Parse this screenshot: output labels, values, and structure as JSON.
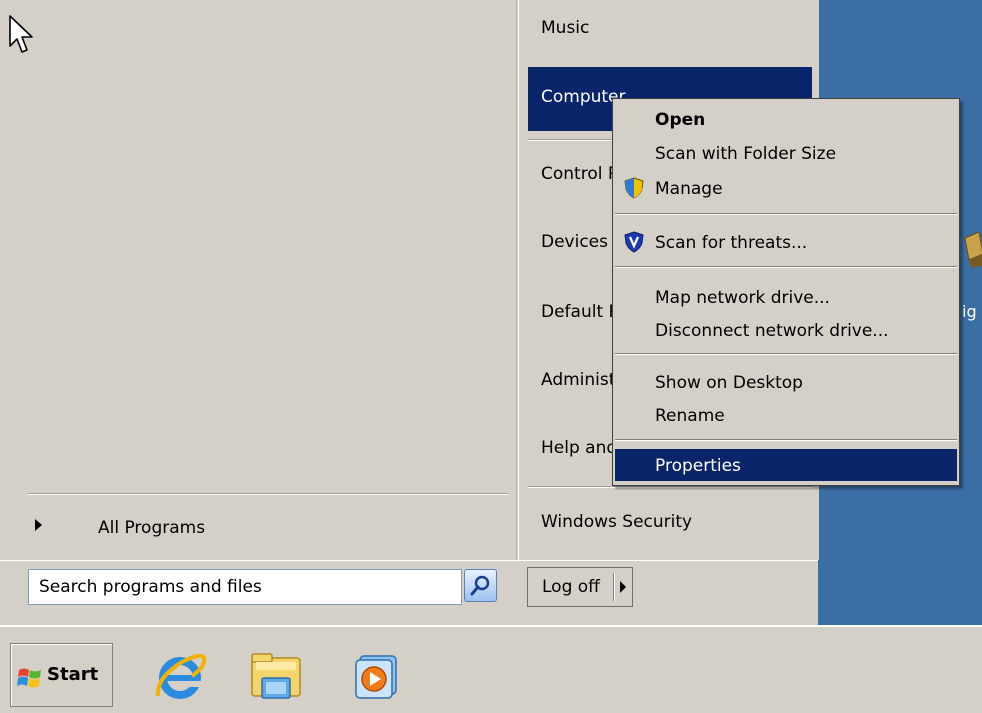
{
  "start_menu": {
    "right_pane": {
      "items": [
        {
          "label": "Music"
        },
        {
          "label": "Computer"
        },
        {
          "label": "Control Panel"
        },
        {
          "label": "Devices and Printers"
        },
        {
          "label": "Default Programs"
        },
        {
          "label": "Administrative Tools"
        },
        {
          "label": "Help and Support"
        },
        {
          "label": "Windows Security"
        }
      ]
    },
    "all_programs": "All Programs",
    "search": {
      "placeholder": "Search programs and files"
    },
    "logoff": "Log off"
  },
  "context_menu": {
    "items": [
      {
        "label": "Open"
      },
      {
        "label": "Scan with Folder Size"
      },
      {
        "label": "Manage"
      },
      {
        "label": "Scan for threats..."
      },
      {
        "label": "Map network drive..."
      },
      {
        "label": "Disconnect network drive..."
      },
      {
        "label": "Show on Desktop"
      },
      {
        "label": "Rename"
      },
      {
        "label": "Properties"
      }
    ]
  },
  "taskbar": {
    "start_label": "Start",
    "pinned": [
      "internet-explorer-icon",
      "windows-explorer-icon",
      "media-player-icon"
    ]
  },
  "desktop": {
    "icon_label": "ig"
  },
  "colors": {
    "menu_bg": "#d4d0c8",
    "highlight": "#0a246a",
    "desktop": "#3a6ea5"
  }
}
